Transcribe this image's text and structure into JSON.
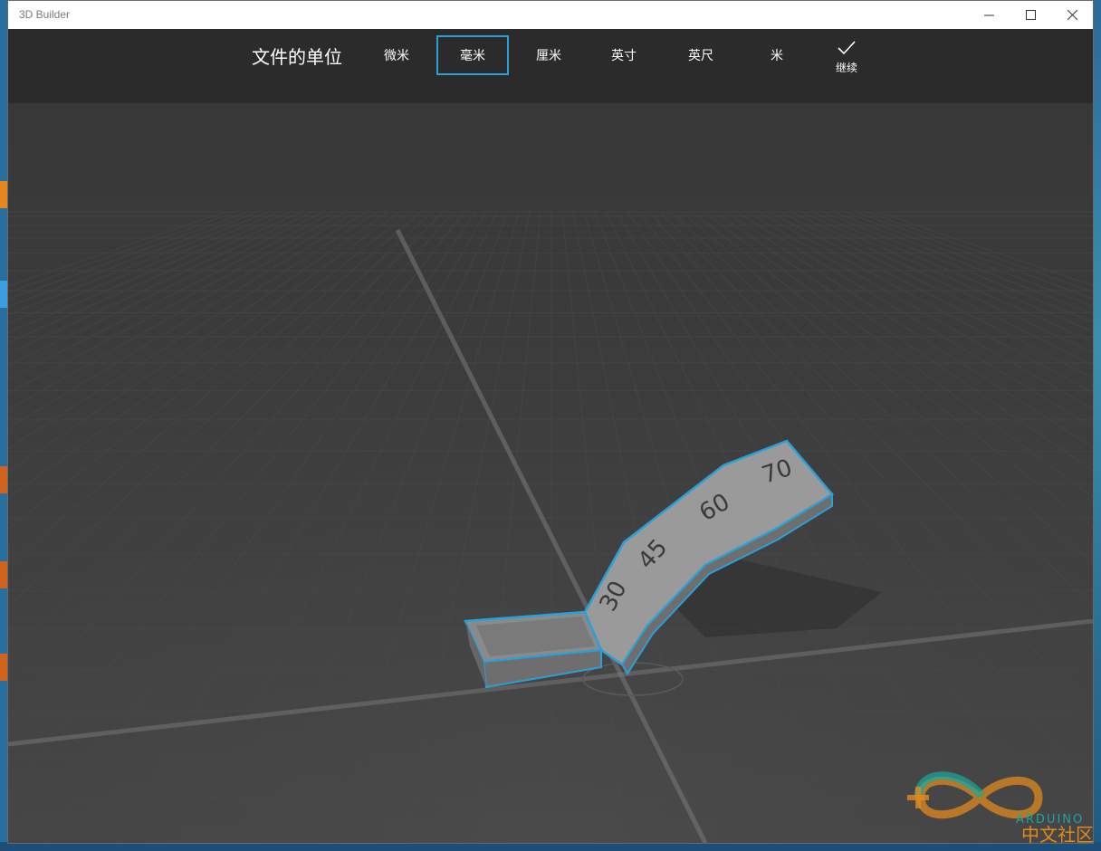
{
  "window": {
    "title": "3D Builder",
    "controls": {
      "minimize_icon": "minimize-icon",
      "maximize_icon": "maximize-icon",
      "close_icon": "close-icon"
    }
  },
  "units_bar": {
    "label": "文件的单位",
    "options": [
      {
        "label": "微米",
        "selected": false
      },
      {
        "label": "毫米",
        "selected": true
      },
      {
        "label": "厘米",
        "selected": false
      },
      {
        "label": "英寸",
        "selected": false
      },
      {
        "label": "英尺",
        "selected": false
      },
      {
        "label": "米",
        "selected": false
      }
    ],
    "continue_label": "继续",
    "continue_icon": "checkmark-icon",
    "accent_color": "#2aa0d8"
  },
  "model": {
    "angle_labels": [
      "30",
      "45",
      "60",
      "70"
    ],
    "outline_color": "#2aa0d8"
  },
  "watermark": {
    "brand": "ARDUINO",
    "text": "中文社区"
  }
}
